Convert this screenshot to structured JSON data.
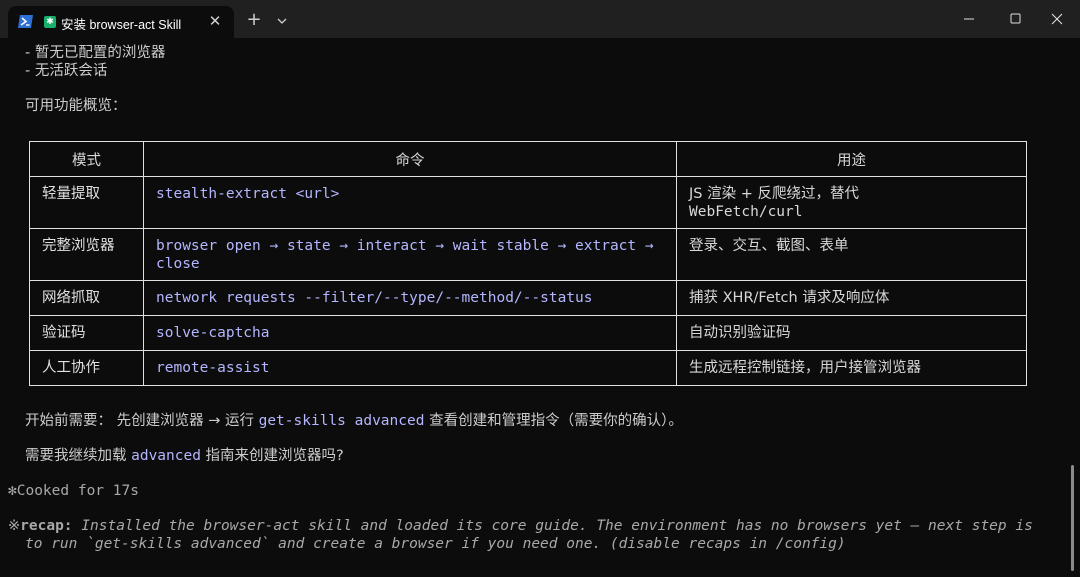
{
  "tab": {
    "title": "安装 browser-act Skill",
    "close_glyph": "✕",
    "new_tab_glyph": "+",
    "icon": "powershell-icon"
  },
  "window": {
    "min": "minimize-icon",
    "max": "maximize-icon",
    "close": "close-icon"
  },
  "status": {
    "line1": "- 暂无已配置的浏览器",
    "line2": "- 无活跃会话"
  },
  "overview_heading": "可用功能概览：",
  "table": {
    "headers": [
      "模式",
      "命令",
      "用途"
    ],
    "rows": [
      {
        "mode": "轻量提取",
        "cmd": "stealth-extract <url>",
        "use1": "JS 渲染 + 反爬绕过，替代",
        "use2": "WebFetch/curl"
      },
      {
        "mode": "完整浏览器",
        "cmd": "browser open → state → interact → wait stable → extract →",
        "cmd2": "close",
        "use1": "登录、交互、截图、表单"
      },
      {
        "mode": "网络抓取",
        "cmd": "network requests --filter/--type/--method/--status",
        "use1": "捕获 XHR/Fetch 请求及响应体"
      },
      {
        "mode": "验证码",
        "cmd": "solve-captcha",
        "use1": "自动识别验证码"
      },
      {
        "mode": "人工协作",
        "cmd": "remote-assist",
        "use1": "生成远程控制链接，用户接管浏览器"
      }
    ]
  },
  "prereq": {
    "label": "开始前需要：",
    "text1": " 先创建浏览器 → 运行 ",
    "cmd": "get-skills advanced",
    "text2": " 查看创建和管理指令（需要你的确认）。"
  },
  "question": {
    "text1": "需要我继续加载 ",
    "cmd": "advanced",
    "text2": " 指南来创建浏览器吗?"
  },
  "cooked": {
    "glyph": "✻",
    "text": "Cooked for 17s"
  },
  "recap": {
    "glyph": "※",
    "label": "recap:",
    "line1": " Installed the browser-act skill and loaded its core guide. The environment has no browsers yet — next step is",
    "line2": "to run `get-skills advanced` and create a browser if you need one. (disable recaps in /config)"
  }
}
